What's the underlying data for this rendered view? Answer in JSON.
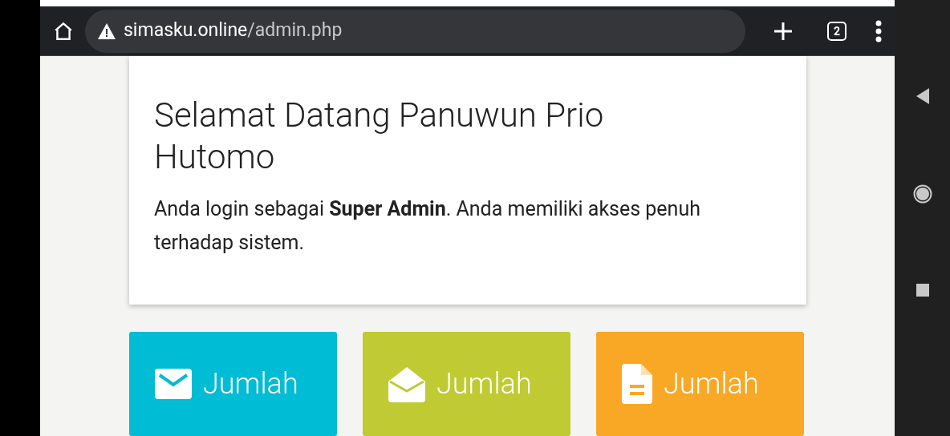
{
  "browser": {
    "url_domain": "simasku.online",
    "url_path": "/admin.php",
    "tab_count": "2"
  },
  "welcome": {
    "title": "Selamat Datang Panuwun Prio Hutomo",
    "message": "Anda login sebagai **Super Admin**. Anda memiliki akses penuh terhadap sistem."
  },
  "tiles": [
    {
      "kind": "mail",
      "label": "Jumlah",
      "color": "#00bcd4"
    },
    {
      "kind": "open-mail",
      "label": "Jumlah",
      "color": "#c0ca33"
    },
    {
      "kind": "document",
      "label": "Jumlah",
      "color": "#f9a825"
    }
  ]
}
